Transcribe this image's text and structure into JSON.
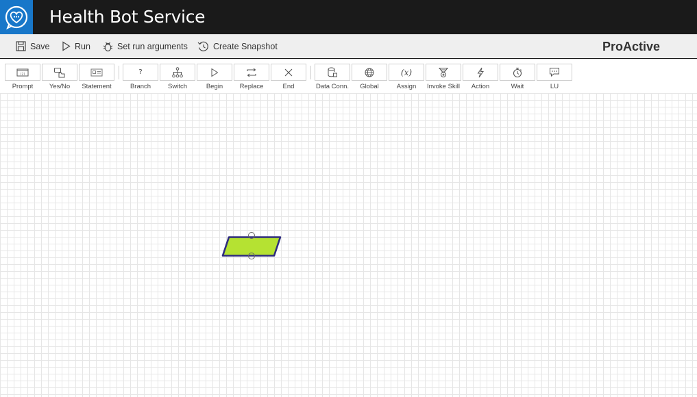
{
  "header": {
    "title": "Health Bot Service",
    "logo_icon": "heart-chat-icon",
    "background": "#1a1a1a",
    "logo_background": "#1877c9"
  },
  "commandbar": {
    "save_label": "Save",
    "run_label": "Run",
    "set_run_arguments_label": "Set run arguments",
    "create_snapshot_label": "Create Snapshot",
    "flow_name": "ProActive"
  },
  "toolbox": {
    "items": [
      {
        "label": "Prompt",
        "icon": "prompt-icon"
      },
      {
        "label": "Yes/No",
        "icon": "yes-no-icon"
      },
      {
        "label": "Statement",
        "icon": "statement-icon"
      },
      {
        "label": "Branch",
        "icon": "branch-icon"
      },
      {
        "label": "Switch",
        "icon": "switch-icon"
      },
      {
        "label": "Begin",
        "icon": "begin-icon"
      },
      {
        "label": "Replace",
        "icon": "replace-icon"
      },
      {
        "label": "End",
        "icon": "end-icon"
      },
      {
        "label": "Data Conn.",
        "icon": "data-connection-icon"
      },
      {
        "label": "Global",
        "icon": "global-icon"
      },
      {
        "label": "Assign",
        "icon": "assign-icon"
      },
      {
        "label": "Invoke Skill",
        "icon": "invoke-skill-icon"
      },
      {
        "label": "Action",
        "icon": "action-icon"
      },
      {
        "label": "Wait",
        "icon": "wait-icon"
      },
      {
        "label": "LU",
        "icon": "lu-icon"
      }
    ]
  },
  "canvas": {
    "node_shape": "parallelogram",
    "node_fill": "#b5e232",
    "node_stroke": "#2e2c7e"
  }
}
